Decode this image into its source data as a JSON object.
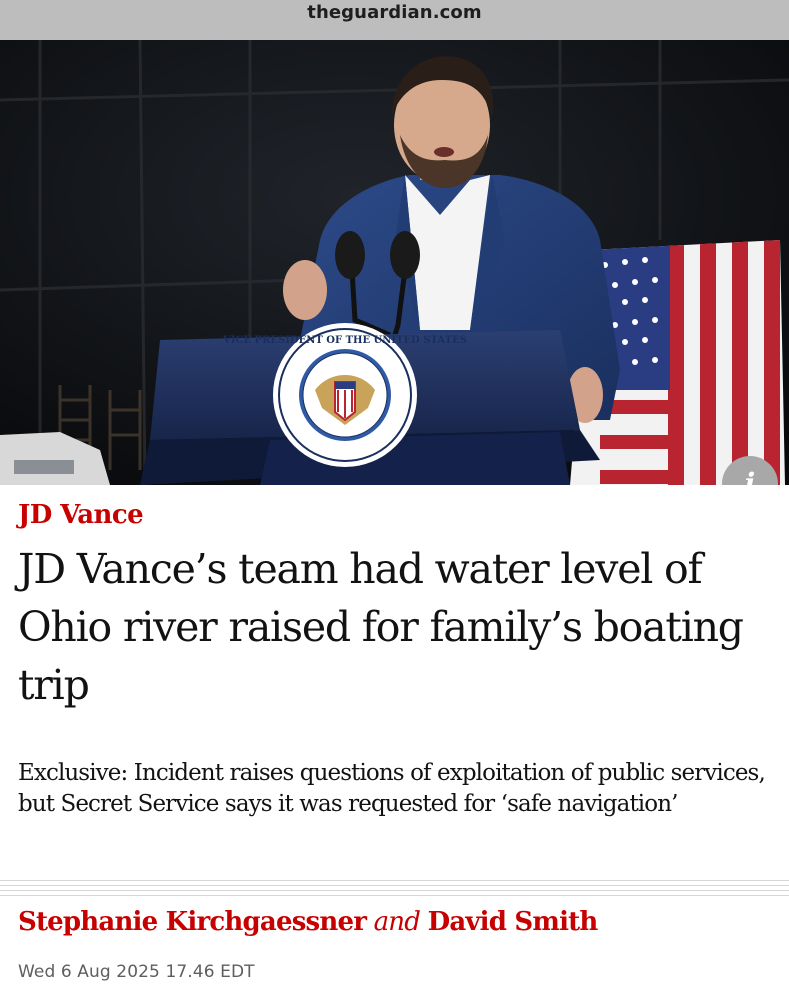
{
  "browser": {
    "domain": "theguardian.com"
  },
  "hero": {
    "seal_text": "VICE PRESIDENT OF THE UNITED STATES",
    "info_glyph": "i",
    "info_icon": "info-icon"
  },
  "article": {
    "section": "JD Vance",
    "headline": "JD Vance’s team had water level of Ohio river raised for family’s boating trip",
    "standfirst": "Exclusive: Incident raises questions of exploitation of public services, but Secret Service says it was requested for ‘safe navigation’",
    "byline": {
      "author1": "Stephanie Kirchgaessner",
      "conjunction": "and",
      "author2": "David Smith"
    },
    "date": "Wed 6 Aug 2025 17.46 EDT"
  },
  "colors": {
    "accent_red": "#c70000",
    "text": "#121212",
    "meta_grey": "#5e5e5e",
    "url_bar": "#bdbdbd"
  }
}
